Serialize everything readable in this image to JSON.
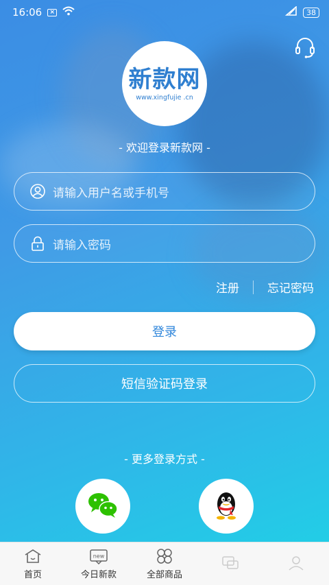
{
  "status_bar": {
    "time": "16:06",
    "notification_badge": "×",
    "battery": "38"
  },
  "logo": {
    "title": "新款网",
    "subtitle": "www.xingfujie .cn"
  },
  "welcome_text": "- 欢迎登录新款网 -",
  "username_field": {
    "placeholder": "请输入用户名或手机号",
    "icon": "user-icon"
  },
  "password_field": {
    "placeholder": "请输入密码",
    "icon": "lock-icon"
  },
  "links": {
    "register": "注册",
    "forgot_password": "忘记密码"
  },
  "buttons": {
    "login": "登录",
    "sms_login": "短信验证码登录"
  },
  "more_login_text": "- 更多登录方式 -",
  "social": [
    {
      "name": "wechat",
      "icon": "wechat-icon"
    },
    {
      "name": "qq",
      "icon": "qq-icon"
    }
  ],
  "tabbar": [
    {
      "label": "首页",
      "icon": "home-icon"
    },
    {
      "label": "今日新款",
      "icon": "new-badge-icon",
      "icon_text": "new"
    },
    {
      "label": "全部商品",
      "icon": "grid-icon"
    },
    {
      "label": "",
      "icon": "chat-icon"
    },
    {
      "label": "",
      "icon": "user-icon"
    }
  ],
  "colors": {
    "accent": "#2f86db",
    "gradient_start": "#3b8de4",
    "gradient_end": "#1fd3e6",
    "wechat_green": "#2dc100"
  }
}
